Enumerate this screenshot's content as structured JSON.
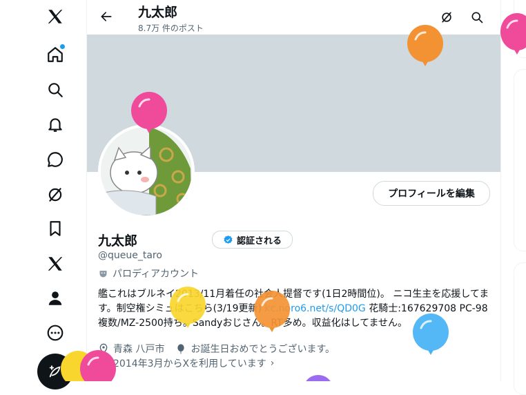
{
  "profile": {
    "name": "九太郎",
    "post_count": "8.7万 件のポスト",
    "handle": "@queue_taro",
    "parody_label": "パロディアカウント",
    "edit_button": "プロフィールを編集",
    "verify_button": "認証される",
    "bio_text_1": "艦これはブルネイ2013/11月着任の社会人提督です(1日2時間位)。 ニコ生主を応援してます。制空権シミュはこちら(3/19更新) ",
    "bio_link": "kc.noro6.net/s/QD0G",
    "bio_text_2": " 花騎士:167629708 PC-98複数/MZ-2500持ち。Sandyおじさん。RT多め。収益化はしてません。",
    "location": "青森 八戸市",
    "birthday_text": "お誕生日おめでとうございます。",
    "joined": "2014年3月からXを利用しています"
  },
  "icons": {
    "nav": [
      "x-logo-icon",
      "home-icon",
      "search-icon",
      "notifications-icon",
      "messages-icon",
      "grok-icon",
      "bookmarks-icon",
      "premium-x-icon",
      "profile-icon",
      "more-icon"
    ],
    "compose": "compose-post-icon",
    "back": "back-arrow-icon",
    "grok_top": "grok-icon",
    "search_top": "search-icon"
  },
  "colors": {
    "accent": "#1d9bf0",
    "banner": "#cfd9de",
    "balloon_pink": "#f04a9b",
    "balloon_orange": "#f39233",
    "balloon_yellow": "#f9d62e",
    "balloon_blue": "#4bb3f5",
    "balloon_purple": "#9b6cf0"
  }
}
